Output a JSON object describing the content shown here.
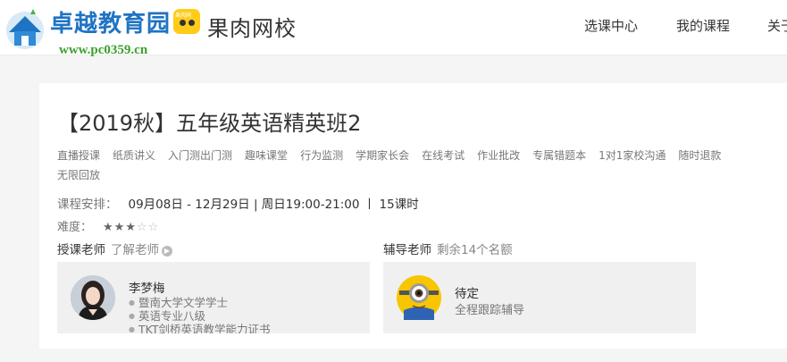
{
  "watermark": {
    "title": "卓越教育园",
    "url": "www.pc0359.cn"
  },
  "brand": {
    "name": "果肉网校",
    "badge_text": "果肉网"
  },
  "nav": {
    "items": [
      "选课中心",
      "我的课程",
      "关于"
    ]
  },
  "course": {
    "title": "【2019秋】五年级英语精英班2",
    "features": [
      "直播授课",
      "纸质讲义",
      "入门测出门测",
      "趣味课堂",
      "行为监测",
      "学期家长会",
      "在线考试",
      "作业批改",
      "专属错题本",
      "1对1家校沟通",
      "随时退款",
      "无限回放"
    ],
    "schedule_label": "课程安排：",
    "schedule_value": "09月08日 - 12月29日 | 周日19:00-21:00 丨 15课时",
    "difficulty_label": "难度：",
    "difficulty_rating": 3,
    "difficulty_max": 5
  },
  "teacher_section": {
    "label": "授课老师",
    "link": "了解老师",
    "name": "李梦梅",
    "credentials": [
      "暨南大学文学学士",
      "英语专业八级",
      "TKT剑桥英语教学能力证书"
    ]
  },
  "tutor_section": {
    "label": "辅导老师",
    "remaining": "剩余14个名额",
    "name": "待定",
    "desc": "全程跟踪辅导"
  },
  "colors": {
    "watermark_blue": "#1f73c4",
    "watermark_green": "#3aa12c",
    "brand_yellow": "#ffcc1a",
    "minion_yellow": "#f7c600"
  },
  "icons": {
    "logo": "house-logo-icon",
    "badge": "guorou-badge-icon",
    "more": "chevron-right-icon",
    "teacher_avatar": "teacher-avatar",
    "tutor_avatar": "minion-avatar"
  }
}
